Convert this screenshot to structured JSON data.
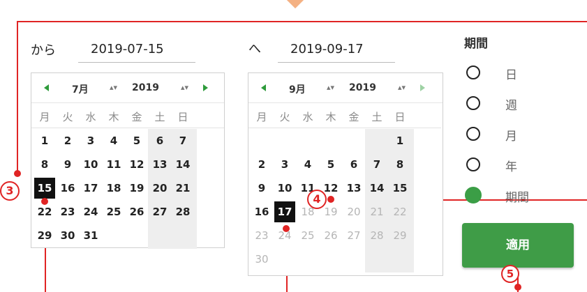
{
  "range": {
    "from_label": "から",
    "from_value": "2019-07-15",
    "to_label": "へ",
    "to_value": "2019-09-17"
  },
  "cal_left": {
    "month": "7月",
    "year": "2019",
    "weekdays": [
      "月",
      "火",
      "水",
      "木",
      "金",
      "土",
      "日"
    ],
    "days": [
      "1",
      "2",
      "3",
      "4",
      "5",
      "6",
      "7",
      "8",
      "9",
      "10",
      "11",
      "12",
      "13",
      "14",
      "15",
      "16",
      "17",
      "18",
      "19",
      "20",
      "21",
      "22",
      "23",
      "24",
      "25",
      "26",
      "27",
      "28",
      "29",
      "30",
      "31"
    ],
    "selected": "15"
  },
  "cal_right": {
    "month": "9月",
    "year": "2019",
    "weekdays": [
      "月",
      "火",
      "水",
      "木",
      "金",
      "土",
      "日"
    ],
    "days": [
      "1",
      "2",
      "3",
      "4",
      "5",
      "6",
      "7",
      "8",
      "9",
      "10",
      "11",
      "12",
      "13",
      "14",
      "15",
      "16",
      "17",
      "18",
      "19",
      "20",
      "21",
      "22",
      "23",
      "24",
      "25",
      "26",
      "27",
      "28",
      "29",
      "30"
    ],
    "selected": "17"
  },
  "period": {
    "title": "期間",
    "options": [
      "日",
      "週",
      "月",
      "年",
      "期間"
    ],
    "selected": "期間"
  },
  "apply_label": "適用",
  "annotations": [
    "3",
    "4",
    "5"
  ],
  "colors": {
    "accent": "#3f9c47",
    "annotation": "#e02424",
    "selected_day": "#111111"
  }
}
